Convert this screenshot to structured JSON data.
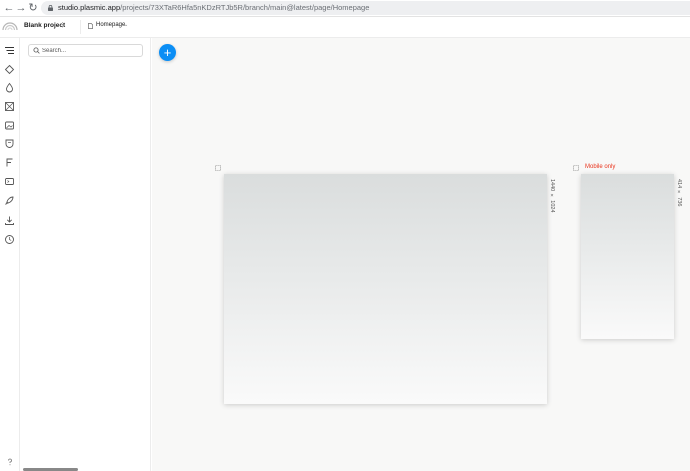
{
  "browser": {
    "back_icon": "arrow-left-icon",
    "forward_icon": "arrow-right-icon",
    "reload_icon": "reload-icon",
    "url_host": "studio.plasmic.app",
    "url_path": "/projects/73XTaR6Hfa5nKDzRTJb5R/branch/main@latest/page/Homepage"
  },
  "header": {
    "project_name": "Blank project",
    "project_menu": "⋮",
    "page_name": "Homepage",
    "page_chevron": "⌄"
  },
  "rail": {
    "icons": [
      "outline-icon",
      "component-icon",
      "drop-icon",
      "image-icon",
      "image-gallery-icon",
      "shield-icon",
      "font-icon",
      "code-icon",
      "rocket-icon",
      "download-icon",
      "history-icon"
    ],
    "bottom_icon": "help-icon"
  },
  "left_panel": {
    "search_placeholder": "Search..."
  },
  "canvas": {
    "add_label": "+",
    "frames": [
      {
        "size_label": "1440 × 1024",
        "label": ""
      },
      {
        "size_label": "414 × 736",
        "label": "Mobile only"
      }
    ]
  },
  "colors": {
    "accent": "#0b8ef5",
    "warning_label": "#e8341c",
    "canvas_bg": "#f8f8f7"
  }
}
